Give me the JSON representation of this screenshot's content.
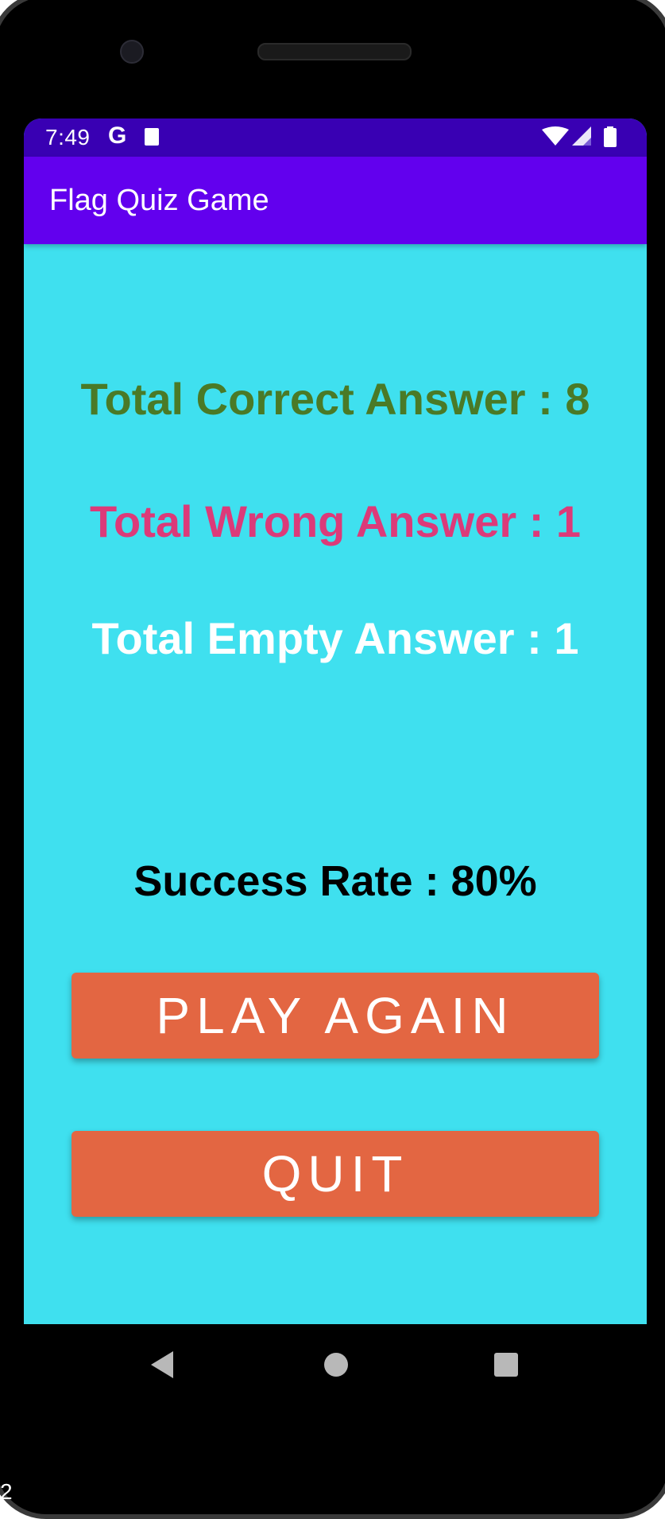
{
  "status_bar": {
    "time": "7:49",
    "g_icon": "G",
    "icons": [
      "google-icon",
      "sd-card-icon",
      "wifi-icon",
      "cellular-signal-icon",
      "battery-icon"
    ]
  },
  "app_bar": {
    "title": "Flag Quiz Game"
  },
  "results": {
    "correct_label": "Total Correct Answer : 8",
    "wrong_label": "Total Wrong Answer : 1",
    "empty_label": "Total Empty Answer : 1",
    "success_rate_label": "Success Rate : 80%"
  },
  "buttons": {
    "play_again": "PLAY AGAIN",
    "quit": "QUIT"
  },
  "nav_bar": {
    "icons": [
      "back-icon",
      "home-icon",
      "recent-apps-icon"
    ]
  },
  "corner_text": "2",
  "colors": {
    "status_bar": "#3900b3",
    "app_bar": "#6200ee",
    "background": "#3fe0ef",
    "correct": "#4a7a27",
    "wrong": "#dc3a79",
    "empty": "#ffffff",
    "button": "#e36642"
  }
}
